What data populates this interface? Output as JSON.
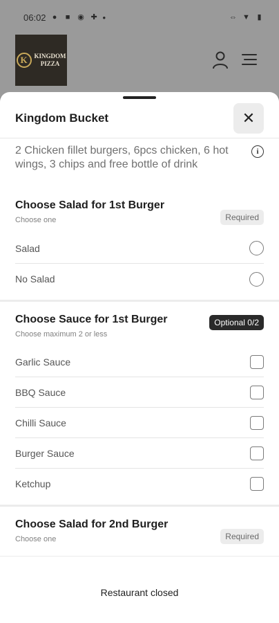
{
  "status_bar": {
    "time": "06:02",
    "left_icons": [
      "notification-icon",
      "media-icon",
      "sync-icon",
      "android-icon"
    ],
    "dot": "•",
    "right_icons": [
      "link-icon",
      "wifi-icon",
      "battery-icon"
    ]
  },
  "background": {
    "logo_text_line1": "KINGDOM",
    "logo_text_line2": "PIZZA",
    "logo_mark": "K"
  },
  "sheet": {
    "title": "Kingdom Bucket",
    "close_label": "✕",
    "description": "2 Chicken fillet burgers, 6pcs chicken, 6 hot wings, 3 chips and free bottle of drink",
    "info_glyph": "i"
  },
  "groups": [
    {
      "title": "Choose Salad for 1st Burger",
      "subtitle": "Choose one",
      "badge": "Required",
      "type": "radio",
      "options": [
        "Salad",
        "No Salad"
      ]
    },
    {
      "title": "Choose Sauce for 1st Burger",
      "subtitle": "Choose maximum 2 or less",
      "badge": "Optional 0/2",
      "type": "checkbox",
      "options": [
        "Garlic Sauce",
        "BBQ Sauce",
        "Chilli Sauce",
        "Burger Sauce",
        "Ketchup"
      ]
    },
    {
      "title": "Choose Salad for 2nd Burger",
      "subtitle": "Choose one",
      "badge": "Required",
      "type": "radio",
      "options": []
    }
  ],
  "footer": {
    "text": "Restaurant closed"
  },
  "colors": {
    "overlay": "#9a9a9a",
    "badge_optional_bg": "#2a2a2a",
    "badge_required_bg": "#ececec"
  }
}
